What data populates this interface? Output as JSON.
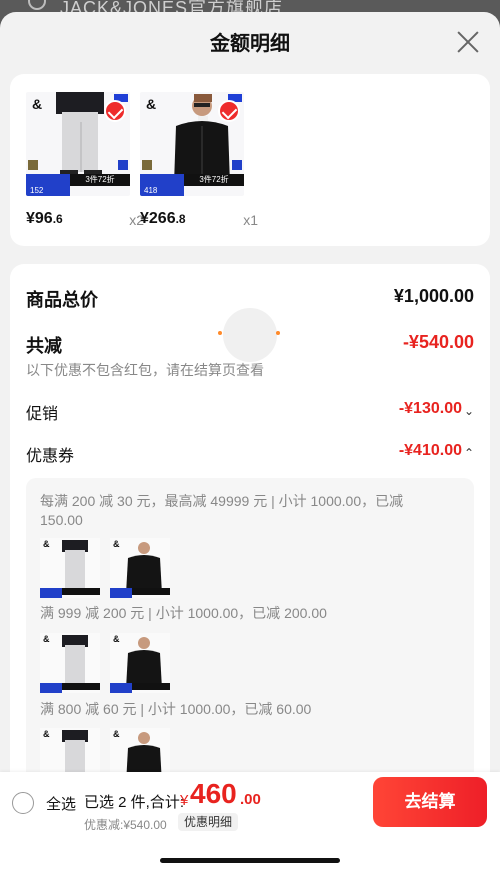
{
  "background": {
    "store_name_partial": "JACK&JONES官方旗舰店"
  },
  "sheet": {
    "title": "金额明细"
  },
  "products": [
    {
      "brand_mark": "&",
      "promo": "3件72折",
      "promo_num": "152",
      "price_int": "¥96",
      "price_dec": ".6",
      "qty": "x2"
    },
    {
      "brand_mark": "&",
      "promo": "3件72折",
      "promo_num": "418",
      "price_int": "¥266",
      "price_dec": ".8",
      "qty": "x1"
    }
  ],
  "detail": {
    "total_label": "商品总价",
    "total_value": "¥1,000.00",
    "discount_label": "共减",
    "discount_value": "-¥540.00",
    "discount_note": "以下优惠不包含红包，请在结算页查看",
    "promo_label": "促销",
    "promo_value": "-¥130.00",
    "coupon_label": "优惠券",
    "coupon_value": "-¥410.00",
    "coupons": [
      {
        "rule": "每满 200 减 30 元，最高减 49999 元 | 小计 1000.00，已减 150.00"
      },
      {
        "rule": "满 999 减 200 元 | 小计 1000.00，已减 200.00"
      },
      {
        "rule": "满 800 减 60 元 | 小计 1000.00，已减 60.00"
      }
    ]
  },
  "bottom_bar": {
    "select_all": "全选",
    "selected_info": "已选 2 件,合计:",
    "currency": "¥",
    "total_int": "460",
    "total_dec": ".00",
    "discount_line": "优惠减:¥540.00",
    "detail_link": "优惠明细",
    "checkout": "去结算"
  },
  "colors": {
    "accent": "#e8231f",
    "checkout_start": "#ff4536",
    "checkout_end": "#ee1f28"
  }
}
